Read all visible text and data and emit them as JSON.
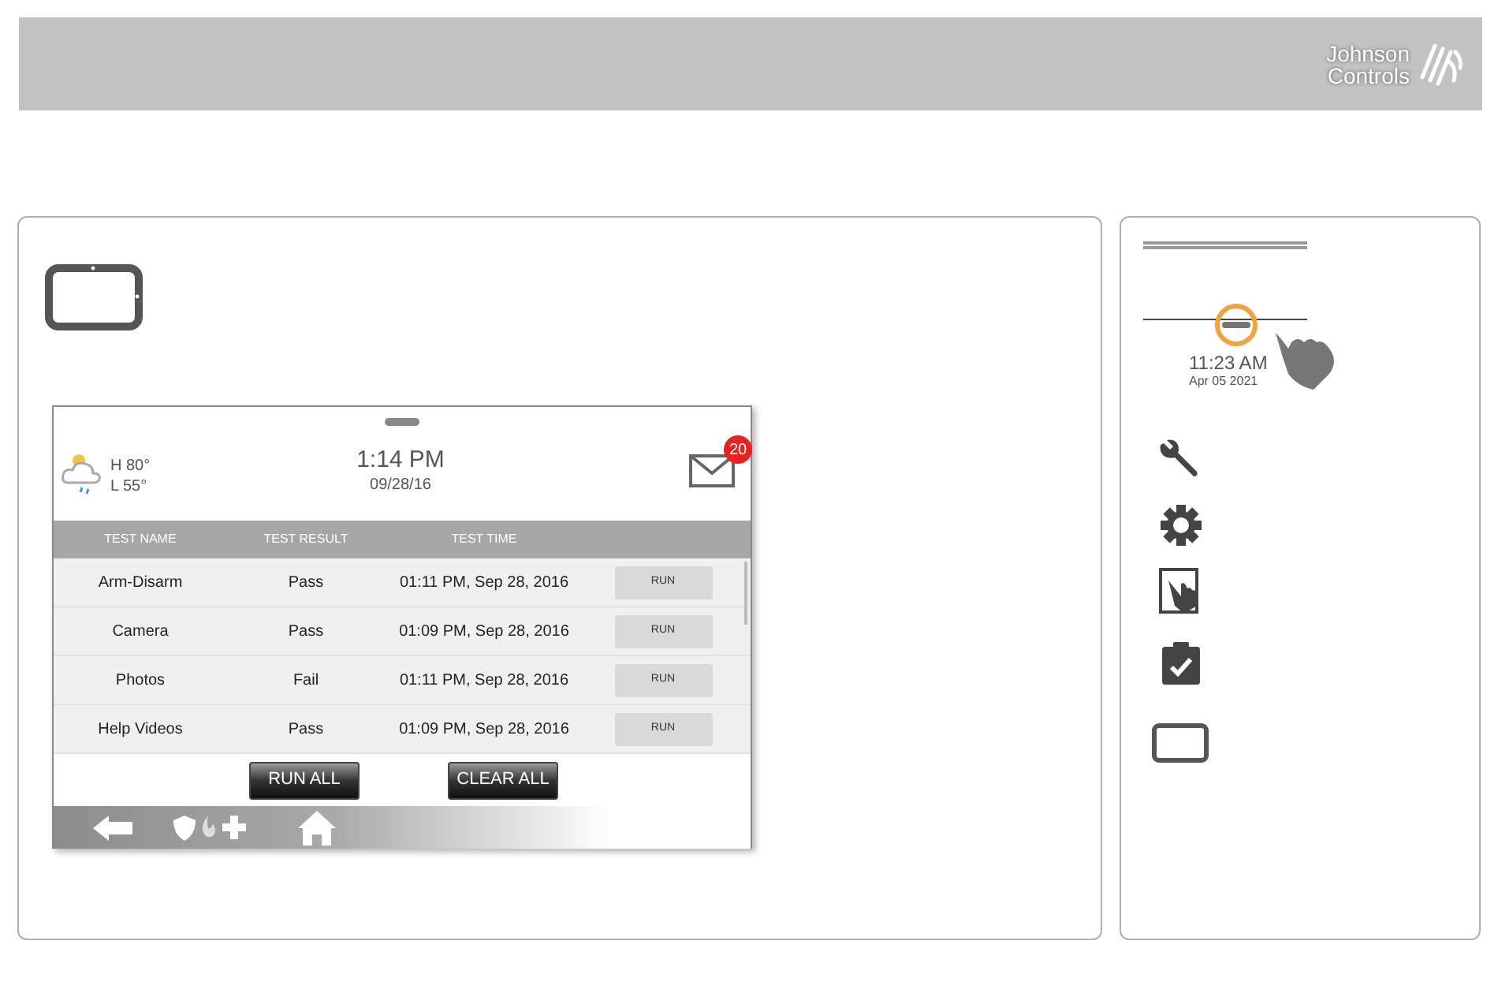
{
  "header": {
    "logo_line_1": "Johnson",
    "logo_line_2": "Controls"
  },
  "device_screen": {
    "weather": {
      "high": "H 80°",
      "low": "L 55°"
    },
    "time": "1:14 PM",
    "date": "09/28/16",
    "message_count": "20",
    "table": {
      "columns": [
        "TEST NAME",
        "TEST RESULT",
        "TEST TIME"
      ],
      "rows": [
        {
          "name": "Arm-Disarm",
          "result": "Pass",
          "time": "01:11 PM, Sep 28, 2016",
          "action": "RUN"
        },
        {
          "name": "Camera",
          "result": "Pass",
          "time": "01:09 PM, Sep 28, 2016",
          "action": "RUN"
        },
        {
          "name": "Photos",
          "result": "Fail",
          "time": "01:11 PM, Sep 28, 2016",
          "action": "RUN"
        },
        {
          "name": "Help Videos",
          "result": "Pass",
          "time": "01:09 PM, Sep 28, 2016",
          "action": "RUN"
        }
      ]
    },
    "buttons": [
      "RUN ALL",
      "CLEAR ALL"
    ]
  },
  "sidebar": {
    "time": "11:23 AM",
    "date": "Apr 05 2021"
  }
}
